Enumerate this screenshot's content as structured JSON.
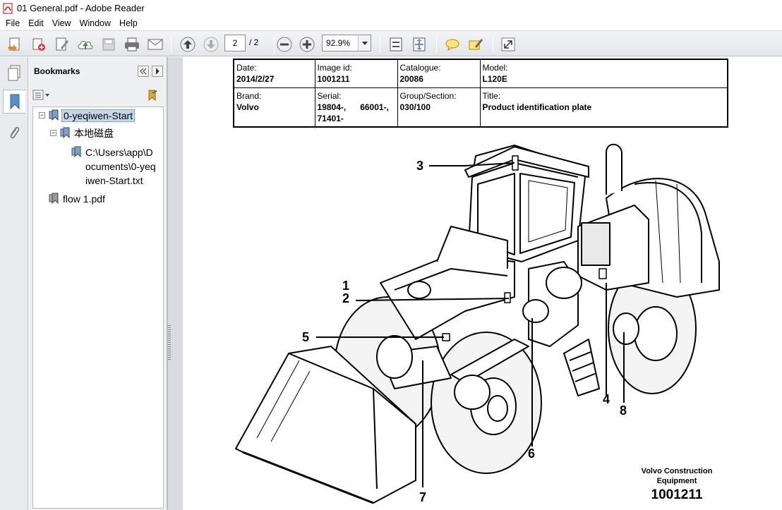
{
  "window": {
    "title": "01 General.pdf - Adobe Reader"
  },
  "menu": [
    "File",
    "Edit",
    "View",
    "Window",
    "Help"
  ],
  "toolbar": {
    "page_current": "2",
    "page_total": "/ 2",
    "zoom": "92.9%"
  },
  "bookmarks": {
    "header": "Bookmarks",
    "items": [
      {
        "label": "0-yeqiwen-Start"
      },
      {
        "label": "本地磁盘"
      },
      {
        "label_lines": [
          "C:\\Users\\app\\D",
          "ocuments\\0-yeq",
          "iwen-Start.txt"
        ]
      },
      {
        "label": "flow 1.pdf"
      }
    ]
  },
  "doc": {
    "table": {
      "row1": [
        {
          "label": "Date:",
          "value": "2014/2/27"
        },
        {
          "label": "Image id:",
          "value": "1001211"
        },
        {
          "label": "Catalogue:",
          "value": "20086"
        },
        {
          "label": "Model:",
          "value": "L120E"
        }
      ],
      "row2": [
        {
          "label": "Brand:",
          "value": "Volvo"
        },
        {
          "label": "Serial:",
          "value": "19804-,      66001-,",
          "value2": "71401-"
        },
        {
          "label": "Group/Section:",
          "value": "030/100"
        },
        {
          "label": "Title:",
          "value": "Product identification plate"
        }
      ]
    },
    "callouts": [
      "1",
      "2",
      "3",
      "4",
      "5",
      "6",
      "7",
      "8"
    ],
    "footer_line1": "Volvo Construction",
    "footer_line2": "Equipment",
    "footer_id": "1001211"
  }
}
